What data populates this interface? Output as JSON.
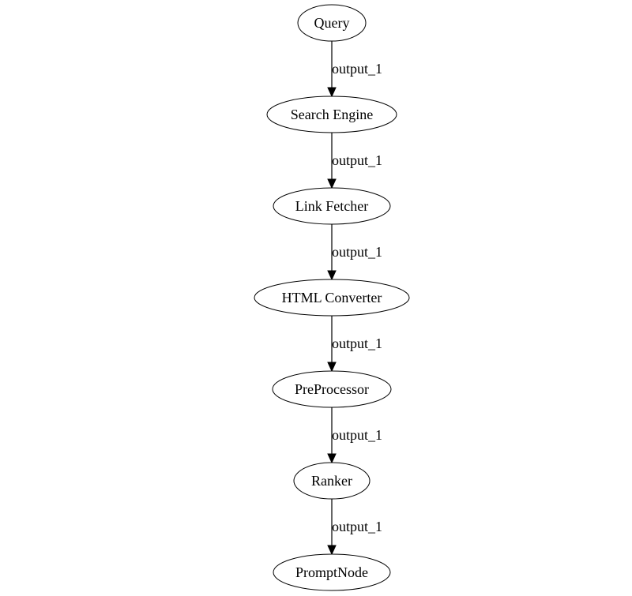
{
  "diagram": {
    "type": "graphviz-digraph",
    "nodes": [
      {
        "id": "query",
        "label": "Query"
      },
      {
        "id": "search_engine",
        "label": "Search Engine"
      },
      {
        "id": "link_fetcher",
        "label": "Link Fetcher"
      },
      {
        "id": "html_converter",
        "label": "HTML Converter"
      },
      {
        "id": "preprocessor",
        "label": "PreProcessor"
      },
      {
        "id": "ranker",
        "label": "Ranker"
      },
      {
        "id": "prompt_node",
        "label": "PromptNode"
      }
    ],
    "edges": [
      {
        "from": "query",
        "to": "search_engine",
        "label": "output_1"
      },
      {
        "from": "search_engine",
        "to": "link_fetcher",
        "label": "output_1"
      },
      {
        "from": "link_fetcher",
        "to": "html_converter",
        "label": "output_1"
      },
      {
        "from": "html_converter",
        "to": "preprocessor",
        "label": "output_1"
      },
      {
        "from": "preprocessor",
        "to": "ranker",
        "label": "output_1"
      },
      {
        "from": "ranker",
        "to": "prompt_node",
        "label": "output_1"
      }
    ]
  }
}
